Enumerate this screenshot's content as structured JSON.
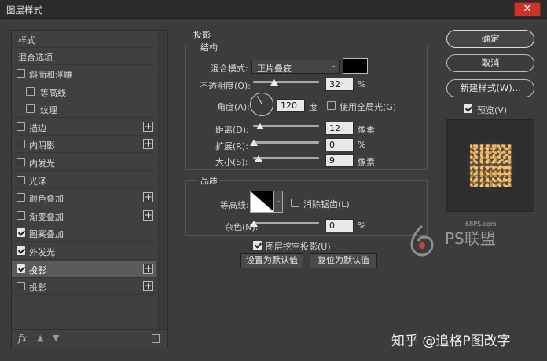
{
  "window": {
    "title": "图层样式",
    "close_glyph": "✕"
  },
  "styles_list": {
    "header": "样式",
    "blend_options": "混合选项",
    "items": [
      {
        "label": "斜面和浮雕",
        "checked": false,
        "indent": false,
        "has_plus": false
      },
      {
        "label": "等高线",
        "checked": false,
        "indent": true,
        "has_plus": false
      },
      {
        "label": "纹理",
        "checked": false,
        "indent": true,
        "has_plus": false
      },
      {
        "label": "描边",
        "checked": false,
        "indent": false,
        "has_plus": true
      },
      {
        "label": "内阴影",
        "checked": false,
        "indent": false,
        "has_plus": true
      },
      {
        "label": "内发光",
        "checked": false,
        "indent": false,
        "has_plus": false
      },
      {
        "label": "光泽",
        "checked": false,
        "indent": false,
        "has_plus": false
      },
      {
        "label": "颜色叠加",
        "checked": false,
        "indent": false,
        "has_plus": true
      },
      {
        "label": "渐变叠加",
        "checked": false,
        "indent": false,
        "has_plus": true
      },
      {
        "label": "图案叠加",
        "checked": true,
        "indent": false,
        "has_plus": false
      },
      {
        "label": "外发光",
        "checked": true,
        "indent": false,
        "has_plus": false
      },
      {
        "label": "投影",
        "checked": true,
        "indent": false,
        "has_plus": true,
        "selected": true
      },
      {
        "label": "投影",
        "checked": false,
        "indent": false,
        "has_plus": true
      }
    ],
    "footer": {
      "fx": "fx",
      "up_icon": "up-arrow-icon",
      "down_icon": "down-arrow-icon",
      "trash_icon": "trash-icon"
    }
  },
  "drop_shadow": {
    "panel_title": "投影",
    "structure": {
      "title": "结构",
      "blend_mode_label": "混合模式:",
      "blend_mode_value": "正片叠底",
      "shadow_color": "#000000",
      "opacity_label": "不透明度(O):",
      "opacity_value": "32",
      "opacity_unit": "%",
      "angle_label": "角度(A):",
      "angle_value": "120",
      "angle_unit": "度",
      "global_light_label": "使用全局光(G)",
      "global_light_checked": false,
      "distance_label": "距离(D):",
      "distance_value": "12",
      "distance_unit": "像素",
      "spread_label": "扩展(R):",
      "spread_value": "0",
      "spread_unit": "%",
      "size_label": "大小(S):",
      "size_value": "9",
      "size_unit": "像素"
    },
    "quality": {
      "title": "品质",
      "contour_label": "等高线:",
      "anti_alias_label": "消除锯齿(L)",
      "anti_alias_checked": false,
      "noise_label": "杂色(N):",
      "noise_value": "0",
      "noise_unit": "%"
    },
    "knockout_label": "图层挖空投影(U)",
    "knockout_checked": true,
    "make_default": "设置为默认值",
    "reset_default": "复位为默认值"
  },
  "actions": {
    "ok": "确定",
    "cancel": "取消",
    "new_style": "新建样式(W)...",
    "preview_label": "预览(V)",
    "preview_checked": true
  },
  "watermarks": {
    "site_small": "68PS.com",
    "site_brand": "PS联盟",
    "zhihu": "知乎 @追格P图改字"
  }
}
